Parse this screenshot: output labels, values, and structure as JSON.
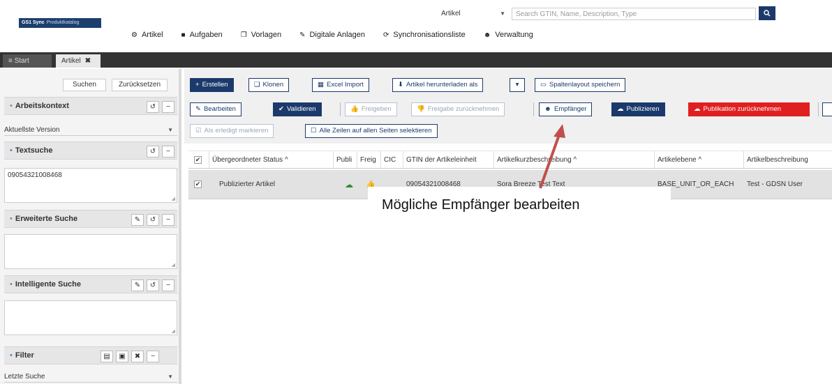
{
  "header": {
    "logo_brand": "GS1 Sync",
    "logo_sub": "Produktkatalog",
    "search_type": "Artikel",
    "search_placeholder": "Search GTIN, Name, Description, Type",
    "nav": [
      {
        "label": "Artikel",
        "icon": "gear-icon"
      },
      {
        "label": "Aufgaben",
        "icon": "tasks-icon"
      },
      {
        "label": "Vorlagen",
        "icon": "copy-icon"
      },
      {
        "label": "Digitale Anlagen",
        "icon": "link-icon"
      },
      {
        "label": "Synchronisationsliste",
        "icon": "refresh-icon"
      },
      {
        "label": "Verwaltung",
        "icon": "users-icon"
      }
    ]
  },
  "tabs": {
    "start": "≡ Start",
    "artikel": "Artikel",
    "close": "✖"
  },
  "sidebar": {
    "search_btn": "Suchen",
    "reset_btn": "Zurücksetzen",
    "arbeitskontext": "Arbeitskontext",
    "aktuellste_version": "Aktuellste Version",
    "textsuche": "Textsuche",
    "textsuche_value": "09054321008468",
    "erweiterte_suche": "Erweiterte Suche",
    "intelligente_suche": "Intelligente Suche",
    "filter": "Filter",
    "letzte_suche": "Letzte Suche"
  },
  "toolbar": {
    "erstellen": "Erstellen",
    "klonen": "Klonen",
    "excel_import": "Excel Import",
    "herunterladen": "Artikel herunterladen als",
    "spaltenlayout": "Spaltenlayout speichern",
    "bearbeiten": "Bearbeiten",
    "validieren": "Validieren",
    "freigeben": "Freigeben",
    "freigabe_zurueck": "Freigabe zurücknehmen",
    "empfaenger": "Empfänger",
    "publizieren": "Publizieren",
    "publikation_zurueck": "Publikation zurücknehmen",
    "als_erledigt": "Als erledigt markieren",
    "alle_zeilen": "Alle Zeilen auf allen Seiten selektieren"
  },
  "table": {
    "headers": [
      "Übergeordneter Status ^",
      "Publi",
      "Freig",
      "CIC",
      "GTIN der Artikeleinheit",
      "Artikelkurzbeschreibung ^",
      "Artikelebene ^",
      "Artikelbeschreibung"
    ],
    "row": {
      "status": "Publizierter Artikel",
      "gtin": "09054321008468",
      "kurz": "Sora Breeze Test Text",
      "ebene": "BASE_UNIT_OR_EACH",
      "beschreibung": "Test - GDSN User"
    }
  },
  "callout": {
    "text": "Mögliche Empfänger bearbeiten"
  },
  "colors": {
    "primary": "#1b3a6b",
    "danger": "#e02020",
    "tabbar": "#333333",
    "arrow": "#c0504d"
  }
}
